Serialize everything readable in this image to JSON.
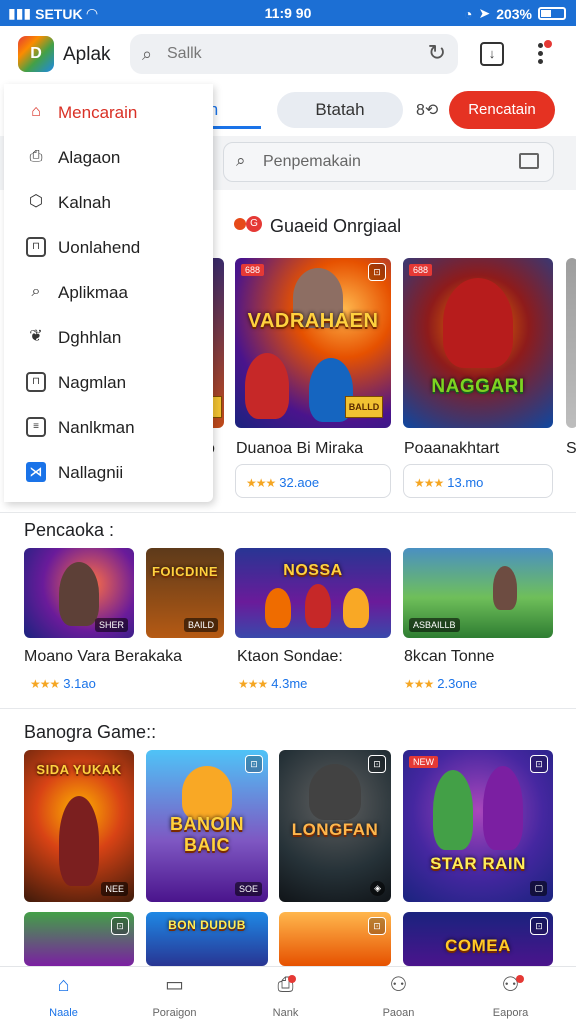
{
  "status_bar": {
    "carrier": "SETUK",
    "time": "11:9 90",
    "battery": "203%"
  },
  "app_bar": {
    "title": "Aplak",
    "search_placeholder": "Sallk"
  },
  "tabs": {
    "active": "in",
    "pill": "Btatah",
    "small": "8",
    "cta": "Rencatain"
  },
  "search": {
    "placeholder": "Penpemakain"
  },
  "drawer": {
    "items": [
      {
        "label": "Mencarain",
        "icon": "home-icon",
        "active": true
      },
      {
        "label": "Alagaon",
        "icon": "bag-icon"
      },
      {
        "label": "Kalnah",
        "icon": "tag-icon"
      },
      {
        "label": "Uonlahend",
        "icon": "lock-icon"
      },
      {
        "label": "Aplikmaa",
        "icon": "search-icon"
      },
      {
        "label": "Dghhlan",
        "icon": "leaf-icon"
      },
      {
        "label": "Nagmlan",
        "icon": "store-icon"
      },
      {
        "label": "Nanlkman",
        "icon": "document-icon"
      },
      {
        "label": "Nallagnii",
        "icon": "app-icon"
      }
    ]
  },
  "featured": {
    "title": "Guaeid Onrgiaal",
    "cards": [
      {
        "art": "VADRAHAEN",
        "badge": "688",
        "name": "Duanoa Bi Miraka",
        "rating": "32.aoe",
        "corner": "BALLD"
      },
      {
        "art": "NAGGARI",
        "badge": "688",
        "name": "Poaanakhtart",
        "rating": "13.mo"
      }
    ],
    "partial_name_left": "o",
    "partial_name_right": "S"
  },
  "section2": {
    "title": "Pencaoka :",
    "cards": [
      {
        "name": "Moano Vara Berakaka",
        "rating": "3.1ao",
        "corner": "SHER",
        "art": ""
      },
      {
        "name": "",
        "rating": "",
        "corner": "BAILD",
        "art": "FOICDINE"
      },
      {
        "name": "Ktaon Sondae:",
        "rating": "4.3me",
        "corner": "",
        "art": "NOSSA"
      },
      {
        "name": "8kcan Tonne",
        "rating": "2.3one",
        "corner": "ASBAILLB",
        "art": ""
      }
    ]
  },
  "section3": {
    "title": "Banogra Game::",
    "cards": [
      {
        "art": "SIDA YUKAK",
        "corner": "NEE"
      },
      {
        "art": "BANOIN BAIC",
        "corner": "SOE"
      },
      {
        "art": "LONGFAN",
        "corner": ""
      },
      {
        "art": "STAR RAIN",
        "corner": ""
      }
    ],
    "row2_art": "COMEA"
  },
  "bottom_nav": [
    {
      "label": "Naale",
      "icon": "home-icon",
      "active": true
    },
    {
      "label": "Poraigon",
      "icon": "document-icon"
    },
    {
      "label": "Nank",
      "icon": "bag-icon"
    },
    {
      "label": "Paoan",
      "icon": "user-icon"
    },
    {
      "label": "Eapora",
      "icon": "user-icon"
    }
  ]
}
